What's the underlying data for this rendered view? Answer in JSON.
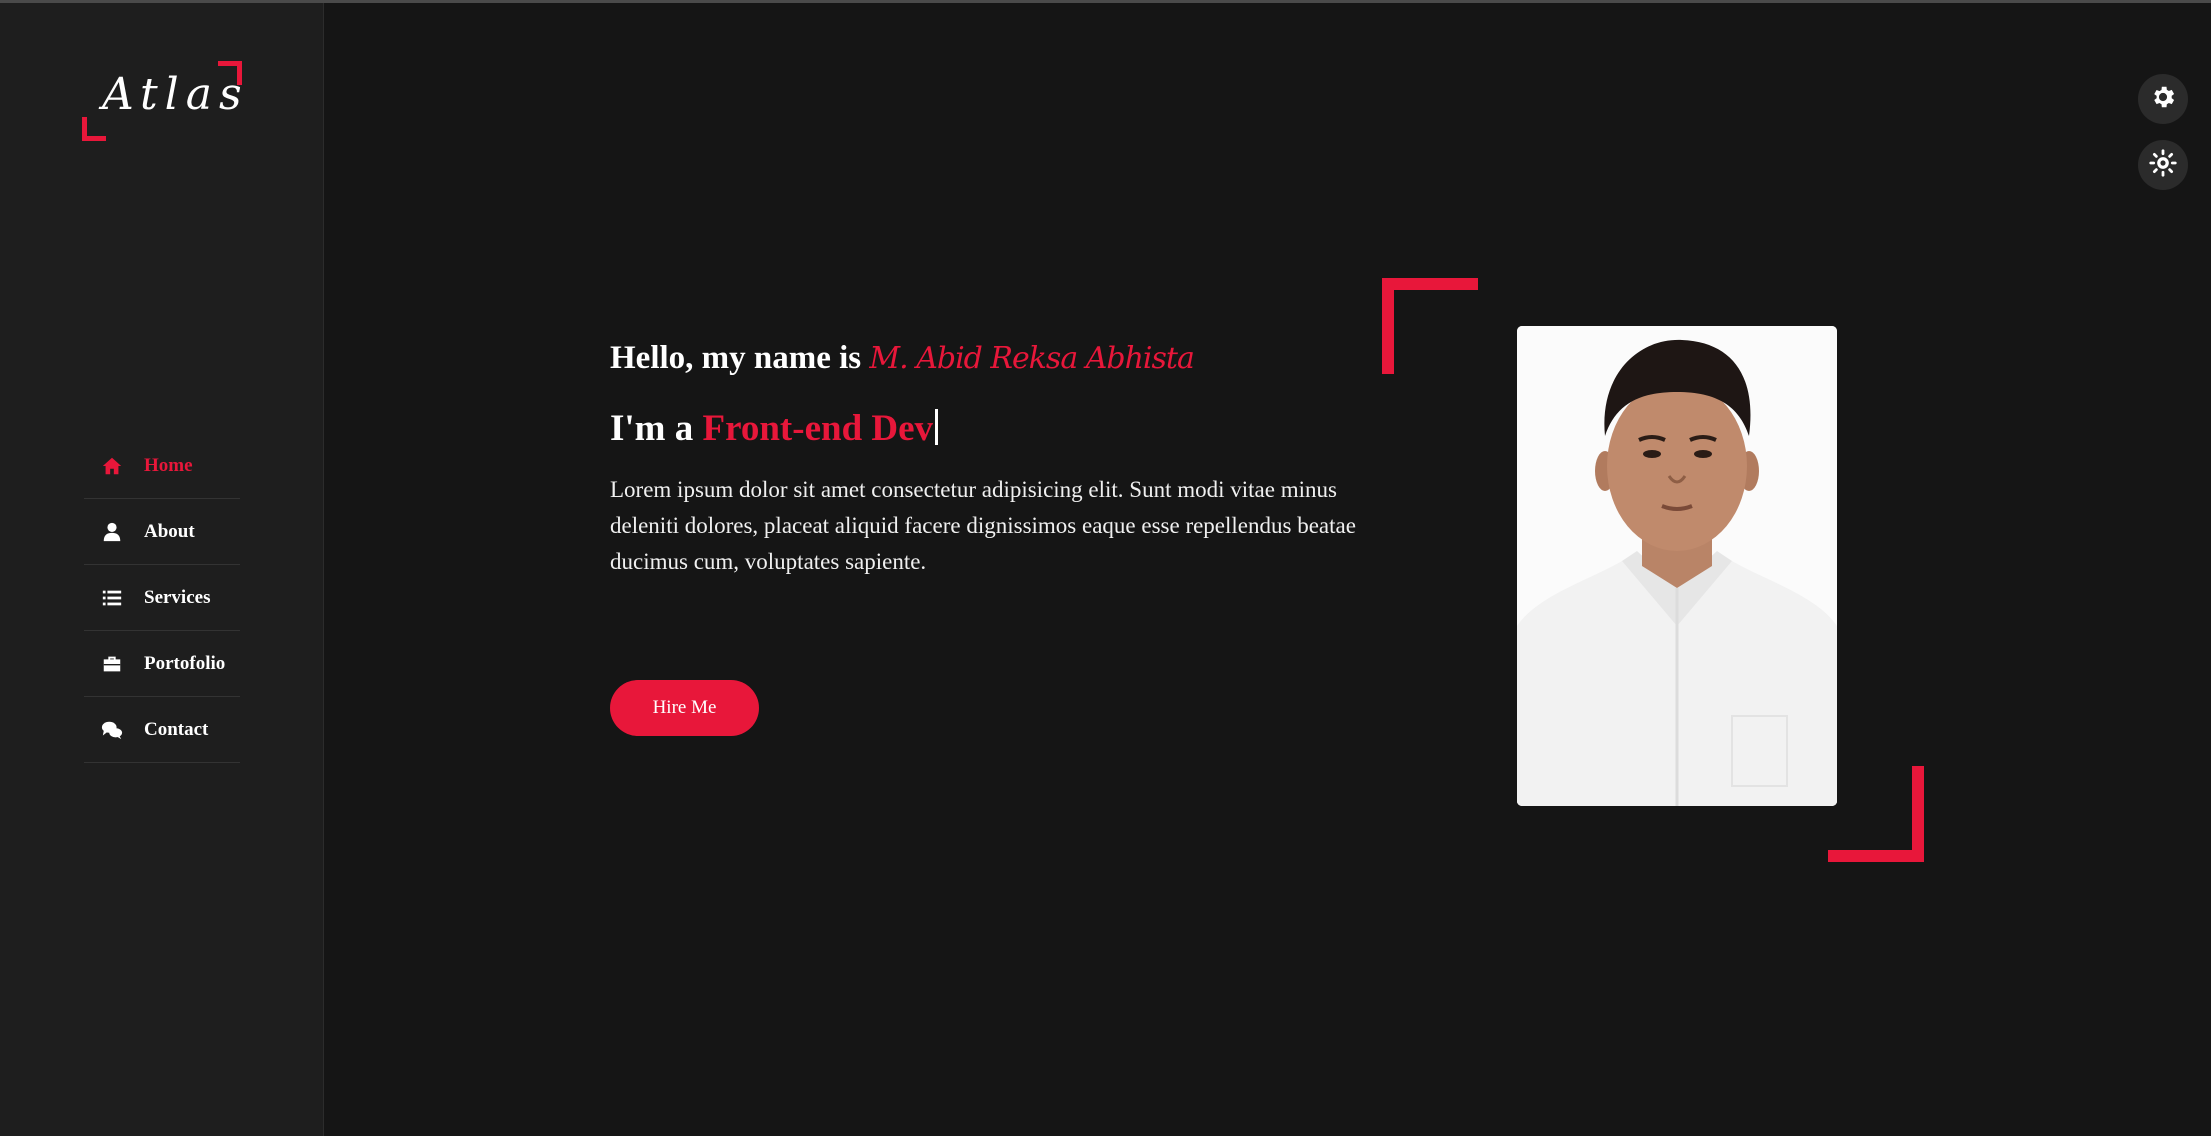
{
  "sidebar": {
    "logo_text": "Atlas",
    "items": [
      {
        "label": "Home",
        "icon": "home-icon",
        "active": true
      },
      {
        "label": "About",
        "icon": "user-icon",
        "active": false
      },
      {
        "label": "Services",
        "icon": "list-icon",
        "active": false
      },
      {
        "label": "Portofolio",
        "icon": "briefcase-icon",
        "active": false
      },
      {
        "label": "Contact",
        "icon": "comments-icon",
        "active": false
      }
    ]
  },
  "settings": {
    "buttons": [
      {
        "icon": "gear-icon"
      },
      {
        "icon": "sun-icon"
      }
    ]
  },
  "hero": {
    "greeting": "Hello, my name is",
    "name": "M. Abid Reksa Abhista",
    "role_prefix": "I'm a",
    "role": "Front-end Dev",
    "description": "Lorem ipsum dolor sit amet consectetur adipisicing elit. Sunt modi vitae minus deleniti dolores, placeat aliquid facere dignissimos eaque esse repellendus beatae ducimus cum, voluptates sapiente.",
    "cta_label": "Hire Me"
  },
  "colors": {
    "accent": "#e8173a",
    "background": "#151515",
    "sidebar": "#1e1e1e"
  }
}
